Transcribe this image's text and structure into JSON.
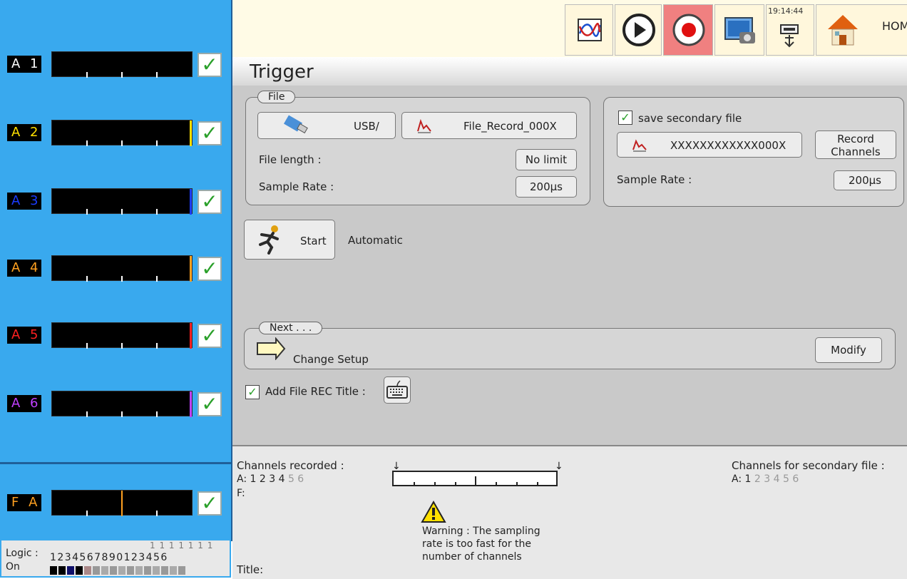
{
  "sidebar": {
    "channels": [
      {
        "label": "A 1",
        "color": "#ffffff"
      },
      {
        "label": "A 2",
        "color": "#ffe000"
      },
      {
        "label": "A 3",
        "color": "#1a3cff"
      },
      {
        "label": "A 4",
        "color": "#ffa020"
      },
      {
        "label": "A 5",
        "color": "#ff2020"
      },
      {
        "label": "A 6",
        "color": "#c040ff"
      }
    ],
    "fa": {
      "label": "F A",
      "color": "#ffa020"
    },
    "logic": {
      "label": "Logic :",
      "state": "On",
      "digits_top": "1 1 1 1 1 1 1",
      "digits_bottom": "1 2 3 4 5 6 7 8 9 0 1 2 3 4 5 6",
      "mini_values": "0 0 1 0"
    }
  },
  "topbar": {
    "time": "19:14:44",
    "home_label": "HOM"
  },
  "main": {
    "title": "Trigger",
    "file_group": {
      "legend": "File",
      "usb_label": "USB/",
      "file_name": "File_Record_000X",
      "file_length_label": "File length :",
      "file_length_value": "No limit",
      "sample_rate_label": "Sample Rate :",
      "sample_rate_value": "200µs"
    },
    "secondary": {
      "checkbox_label": "save secondary file",
      "file_name": "XXXXXXXXXXXX000X",
      "record_line1": "Record",
      "record_line2": "Channels",
      "sample_rate_label": "Sample Rate :",
      "sample_rate_value": "200µs"
    },
    "start": {
      "label": "Start",
      "mode": "Automatic"
    },
    "next": {
      "legend": "Next . . .",
      "text": "Change Setup",
      "modify": "Modify"
    },
    "add_title": {
      "label": "Add File REC Title :"
    }
  },
  "bottom": {
    "recorded_label": "Channels recorded :",
    "recorded_prefix": "A:",
    "recorded_active": "1 2 3 4",
    "recorded_inactive": "5 6",
    "f_label": "F:",
    "secondary_label": "Channels for secondary file :",
    "secondary_prefix": "A:",
    "secondary_active": "1",
    "secondary_inactive": "2 3 4 5 6",
    "warning": "Warning : The sampling rate is too fast for the number of channels",
    "warning_line1": "Warning : The sampling",
    "warning_line2": "rate is too fast for the",
    "warning_line3": "number of channels",
    "title_label": "Title:"
  },
  "icons": [
    "chart-icon",
    "play-icon",
    "record-icon",
    "screenshot-icon",
    "usb-memory-icon",
    "home-icon",
    "usb-stick-icon",
    "file-chart-icon",
    "runner-icon",
    "arrow-right-icon",
    "keyboard-icon",
    "warning-icon"
  ]
}
